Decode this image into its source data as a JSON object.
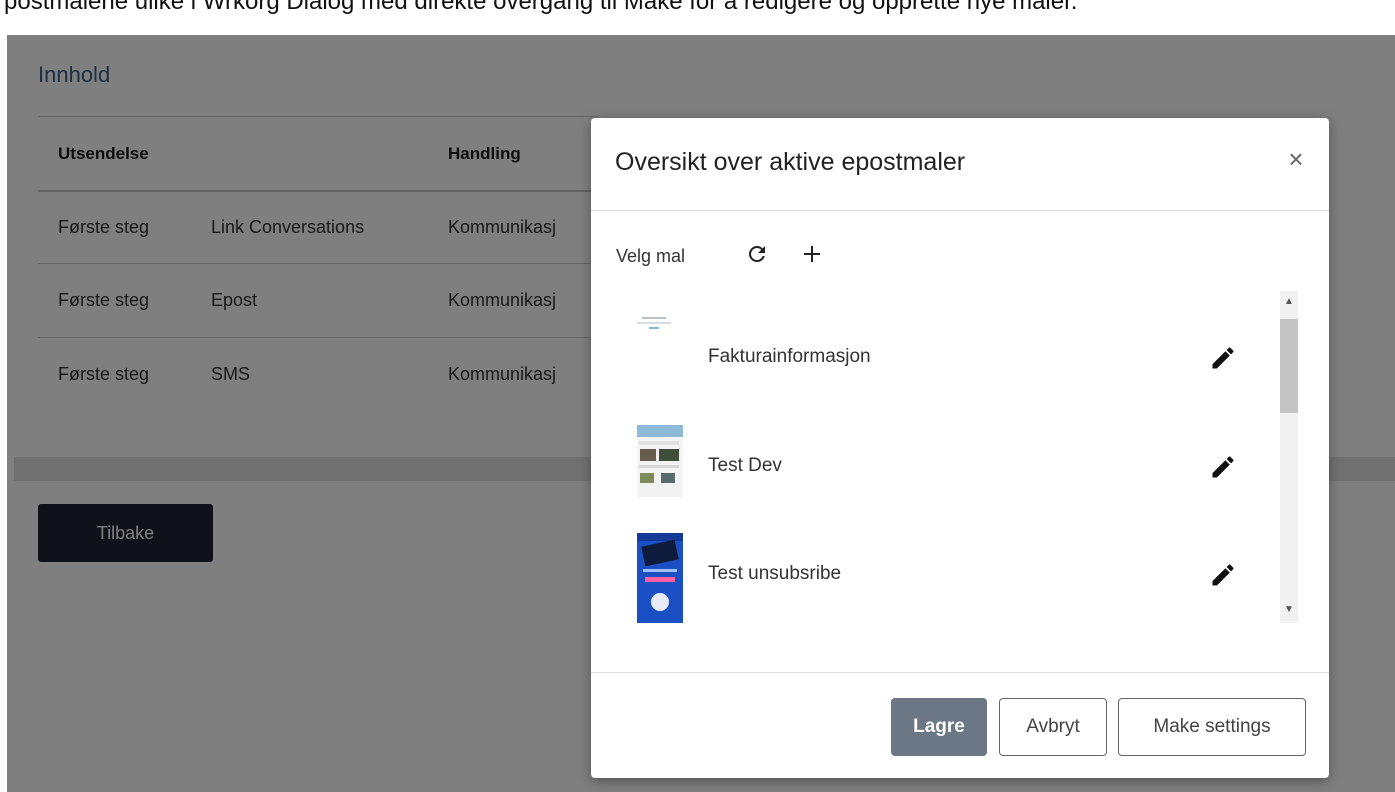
{
  "caption": "postmalene ulike i Wrkorg Dialog med direkte overgang til Make for å redigere og opprette nye maler.",
  "page": {
    "card_title": "Innhold",
    "table": {
      "headers": [
        "Utsendelse",
        "Handling"
      ],
      "rows": [
        {
          "step": "Første steg",
          "type": "Link Conversations",
          "action": "Kommunikasj"
        },
        {
          "step": "Første steg",
          "type": "Epost",
          "action": "Kommunikasj"
        },
        {
          "step": "Første steg",
          "type": "SMS",
          "action": "Kommunikasj"
        }
      ]
    },
    "back_label": "Tilbake"
  },
  "modal": {
    "title": "Oversikt over aktive epostmaler",
    "close_symbol": "×",
    "select_label": "Velg mal",
    "toolbar_icons": [
      "refresh-icon",
      "plus-icon"
    ],
    "templates": [
      {
        "name": "Fakturainformasjon",
        "thumb_style": "light"
      },
      {
        "name": "Test Dev",
        "thumb_style": "photo"
      },
      {
        "name": "Test unsubsribe",
        "thumb_style": "blue"
      }
    ],
    "buttons": {
      "save": "Lagre",
      "cancel": "Avbryt",
      "make_settings": "Make settings"
    }
  },
  "colors": {
    "overlay": "rgba(0,0,0,0.5)",
    "back_button": "#1f2733",
    "save_button": "#6c7786",
    "title_blue": "#3f5f86"
  }
}
